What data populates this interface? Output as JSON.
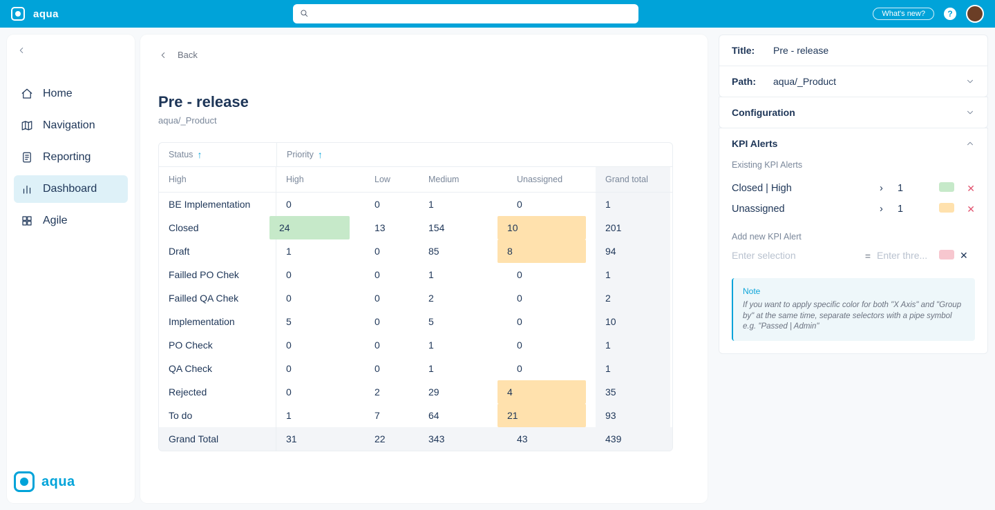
{
  "brand": "aqua",
  "topbar": {
    "whats_new": "What's new?",
    "search_placeholder": ""
  },
  "sidebar": {
    "items": [
      {
        "key": "home",
        "label": "Home"
      },
      {
        "key": "navigation",
        "label": "Navigation"
      },
      {
        "key": "reporting",
        "label": "Reporting"
      },
      {
        "key": "dashboard",
        "label": "Dashboard",
        "active": true
      },
      {
        "key": "agile",
        "label": "Agile"
      }
    ]
  },
  "page": {
    "back": "Back",
    "title": "Pre - release",
    "path": "aqua/_Product"
  },
  "pivot": {
    "row_dim_label": "Status",
    "col_dim_label": "Priority",
    "row_band_label": "High",
    "columns": [
      "High",
      "Low",
      "Medium",
      "Unassigned",
      "Grand total"
    ],
    "rows": [
      {
        "label": "BE Implementation",
        "cells": [
          "0",
          "0",
          "1",
          "0",
          "1"
        ]
      },
      {
        "label": "Closed",
        "cells": [
          "24",
          "13",
          "154",
          "10",
          "201"
        ],
        "hl": {
          "0": "green",
          "3": "orange"
        }
      },
      {
        "label": "Draft",
        "cells": [
          "1",
          "0",
          "85",
          "8",
          "94"
        ],
        "hl": {
          "3": "orange"
        }
      },
      {
        "label": "Failled PO Chek",
        "cells": [
          "0",
          "0",
          "1",
          "0",
          "1"
        ]
      },
      {
        "label": "Failled QA Chek",
        "cells": [
          "0",
          "0",
          "2",
          "0",
          "2"
        ]
      },
      {
        "label": "Implementation",
        "cells": [
          "5",
          "0",
          "5",
          "0",
          "10"
        ]
      },
      {
        "label": "PO Check",
        "cells": [
          "0",
          "0",
          "1",
          "0",
          "1"
        ]
      },
      {
        "label": "QA Check",
        "cells": [
          "0",
          "0",
          "1",
          "0",
          "1"
        ]
      },
      {
        "label": "Rejected",
        "cells": [
          "0",
          "2",
          "29",
          "4",
          "35"
        ],
        "hl": {
          "3": "orange"
        }
      },
      {
        "label": "To do",
        "cells": [
          "1",
          "7",
          "64",
          "21",
          "93"
        ],
        "hl": {
          "3": "orange"
        }
      }
    ],
    "grand": {
      "label": "Grand Total",
      "cells": [
        "31",
        "22",
        "343",
        "43",
        "439"
      ]
    }
  },
  "right": {
    "title_label": "Title:",
    "title_value": "Pre - release",
    "path_label": "Path:",
    "path_value": "aqua/_Product",
    "config_label": "Configuration",
    "kpi_label": "KPI Alerts",
    "existing_label": "Existing KPI Alerts",
    "alerts": [
      {
        "name": "Closed | High",
        "threshold": "1",
        "color": "green"
      },
      {
        "name": "Unassigned",
        "threshold": "1",
        "color": "orange"
      }
    ],
    "add_label": "Add new KPI Alert",
    "add_placeholder_sel": "Enter selection",
    "add_placeholder_thr": "Enter thre...",
    "note_title": "Note",
    "note_body": "If you want to apply specific color for both \"X Axis\" and \"Group by\" at the same time, separate selectors with a pipe symbol e.g. \"Passed | Admin\""
  },
  "chart_data": {
    "type": "table",
    "row_dimension": "Status",
    "column_dimension": "Priority",
    "columns": [
      "High",
      "Low",
      "Medium",
      "Unassigned"
    ],
    "rows": [
      "BE Implementation",
      "Closed",
      "Draft",
      "Failled PO Chek",
      "Failled QA Chek",
      "Implementation",
      "PO Check",
      "QA Check",
      "Rejected",
      "To do"
    ],
    "values": [
      [
        0,
        0,
        1,
        0
      ],
      [
        24,
        13,
        154,
        10
      ],
      [
        1,
        0,
        85,
        8
      ],
      [
        0,
        0,
        1,
        0
      ],
      [
        0,
        0,
        2,
        0
      ],
      [
        5,
        0,
        5,
        0
      ],
      [
        0,
        0,
        1,
        0
      ],
      [
        0,
        0,
        1,
        0
      ],
      [
        0,
        2,
        29,
        4
      ],
      [
        1,
        7,
        64,
        21
      ]
    ],
    "row_totals": [
      1,
      201,
      94,
      1,
      2,
      10,
      1,
      1,
      35,
      93
    ],
    "column_totals": [
      31,
      22,
      343,
      43
    ],
    "grand_total": 439
  }
}
